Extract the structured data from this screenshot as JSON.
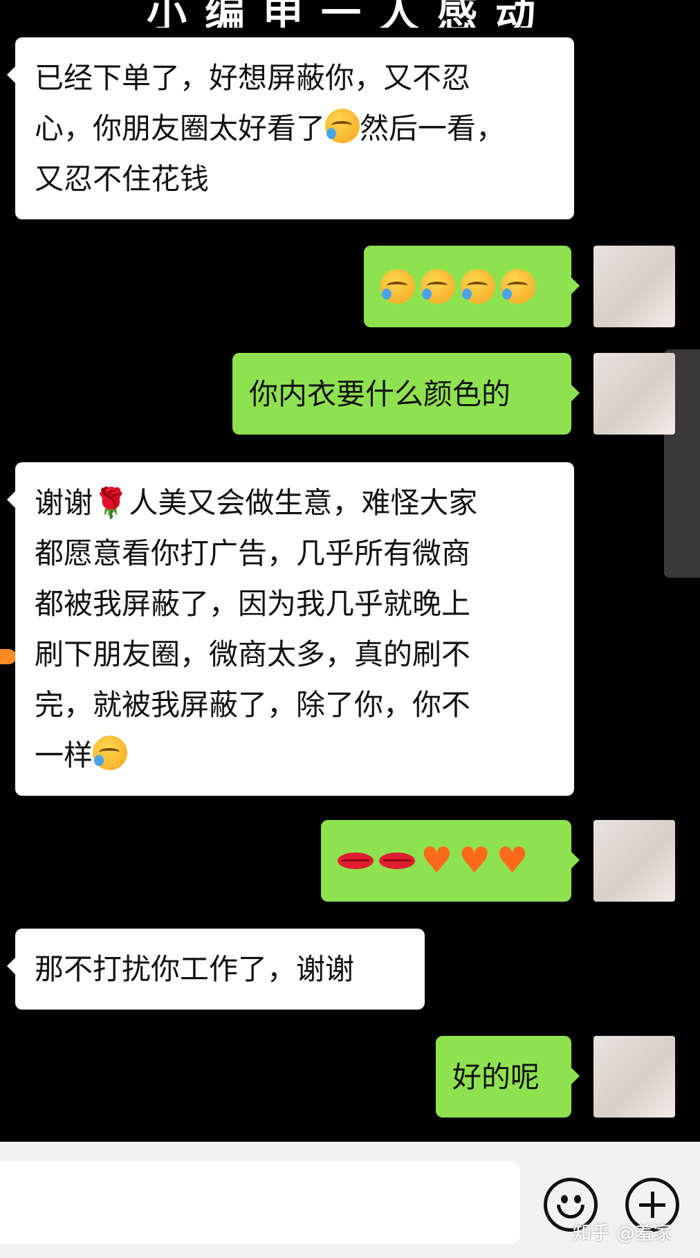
{
  "header": {
    "banner_text": "小编申一人感动"
  },
  "messages": [
    {
      "side": "in",
      "parts": [
        "已经下单了，好想屏蔽你，又不忍",
        "心，你朋友圈太好看了",
        "然后一看，",
        "又忍不住花钱"
      ]
    },
    {
      "side": "out",
      "emojis": [
        "facepalm",
        "facepalm",
        "facepalm",
        "facepalm"
      ]
    },
    {
      "side": "out",
      "text": "你内衣要什么颜色的"
    },
    {
      "side": "in",
      "parts": [
        "谢谢",
        "人美又会做生意，难怪大家",
        "都愿意看你打广告，几乎所有微商",
        "都被我屏蔽了，因为我几乎就晚上",
        "刷下朋友圈，微商太多，真的刷不",
        "完，就被我屏蔽了，除了你，你不",
        "一样"
      ]
    },
    {
      "side": "out",
      "emojis": [
        "lips",
        "lips",
        "heart",
        "heart",
        "heart"
      ]
    },
    {
      "side": "in",
      "text": "那不打扰你工作了，谢谢"
    },
    {
      "side": "out",
      "text": "好的呢"
    }
  ],
  "icons": {
    "emoji_button": "smile-face-icon",
    "more_button": "plus-circle-icon",
    "rose": "rose-emoji-icon",
    "facepalm": "facepalm-emoji-icon"
  },
  "watermark": "知乎 @羞家",
  "colors": {
    "background": "#000000",
    "outgoing_bubble": "#8fe24f",
    "incoming_bubble": "#ffffff",
    "input_bar": "#f2f2f2"
  }
}
